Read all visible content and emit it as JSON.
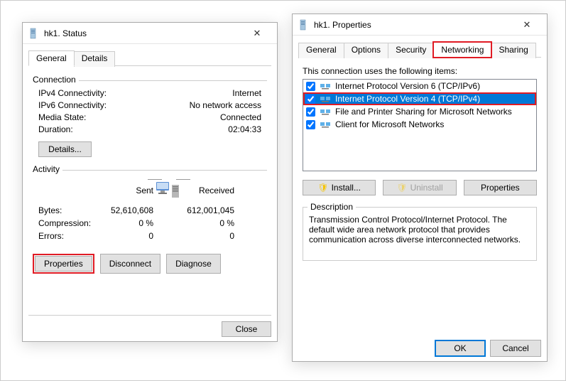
{
  "status": {
    "title": "hk1. Status",
    "tabs": {
      "general": "General",
      "details": "Details"
    },
    "connection_label": "Connection",
    "ipv4_label": "IPv4 Connectivity:",
    "ipv4_value": "Internet",
    "ipv6_label": "IPv6 Connectivity:",
    "ipv6_value": "No network access",
    "media_label": "Media State:",
    "media_value": "Connected",
    "duration_label": "Duration:",
    "duration_value": "02:04:33",
    "details_btn": "Details...",
    "activity_label": "Activity",
    "sent_label": "Sent",
    "received_label": "Received",
    "bytes_label": "Bytes:",
    "bytes_sent": "52,610,608",
    "bytes_recv": "612,001,045",
    "compression_label": "Compression:",
    "compression_sent": "0 %",
    "compression_recv": "0 %",
    "errors_label": "Errors:",
    "errors_sent": "0",
    "errors_recv": "0",
    "properties_btn": "Properties",
    "disconnect_btn": "Disconnect",
    "diagnose_btn": "Diagnose",
    "close_btn": "Close"
  },
  "properties": {
    "title": "hk1. Properties",
    "tabs": {
      "general": "General",
      "options": "Options",
      "security": "Security",
      "networking": "Networking",
      "sharing": "Sharing"
    },
    "items_label": "This connection uses the following items:",
    "items": [
      {
        "label": "Internet Protocol Version 6 (TCP/IPv6)",
        "checked": true,
        "selected": false,
        "highlight": false
      },
      {
        "label": "Internet Protocol Version 4 (TCP/IPv4)",
        "checked": true,
        "selected": true,
        "highlight": true
      },
      {
        "label": "File and Printer Sharing for Microsoft Networks",
        "checked": true,
        "selected": false,
        "highlight": false
      },
      {
        "label": "Client for Microsoft Networks",
        "checked": true,
        "selected": false,
        "highlight": false
      }
    ],
    "install_btn": "Install...",
    "uninstall_btn": "Uninstall",
    "itemprops_btn": "Properties",
    "description_label": "Description",
    "description_text": "Transmission Control Protocol/Internet Protocol. The default wide area network protocol that provides communication across diverse interconnected networks.",
    "ok_btn": "OK",
    "cancel_btn": "Cancel"
  }
}
